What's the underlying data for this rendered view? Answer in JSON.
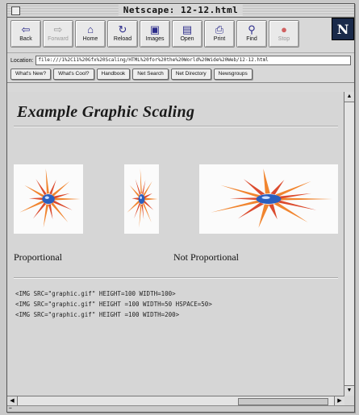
{
  "window": {
    "title": "Netscape: 12-12.html"
  },
  "toolbar": {
    "buttons": [
      {
        "label": "Back",
        "icon": "back-arrow-icon",
        "glyph": "⇦"
      },
      {
        "label": "Forward",
        "icon": "forward-arrow-icon",
        "glyph": "⇨"
      },
      {
        "label": "Home",
        "icon": "home-icon",
        "glyph": "⌂"
      },
      {
        "label": "Reload",
        "icon": "reload-icon",
        "glyph": "↻"
      },
      {
        "label": "Images",
        "icon": "images-icon",
        "glyph": "▣"
      },
      {
        "label": "Open",
        "icon": "open-icon",
        "glyph": "▤"
      },
      {
        "label": "Print",
        "icon": "print-icon",
        "glyph": "⎙"
      },
      {
        "label": "Find",
        "icon": "find-icon",
        "glyph": "⚲"
      },
      {
        "label": "Stop",
        "icon": "stop-icon",
        "glyph": "●"
      }
    ],
    "logo_letter": "N"
  },
  "location": {
    "label": "Location:",
    "url": "file:///1%2C11%20Gfx%20Scaling/HTML%20for%20the%20World%20Wide%20Web/12-12.html"
  },
  "directory_buttons": [
    "What's New?",
    "What's Cool?",
    "Handbook",
    "Net Search",
    "Net Directory",
    "Newsgroups"
  ],
  "page": {
    "heading": "Example Graphic Scaling",
    "caption_left": "Proportional",
    "caption_right": "Not Proportional",
    "code_lines": [
      "<IMG SRC=\"graphic.gif\" HEIGHT=100 WIDTH=100>",
      "<IMG SRC=\"graphic.gif\" HEIGHT =100 WIDTH=50 HSPACE=50>",
      "<IMG SRC=\"graphic.gif\" HEIGHT =100 WIDTH=200>"
    ]
  },
  "colors": {
    "star_orange": "#f07818",
    "star_red": "#d83818",
    "star_center": "#2a5fbf"
  }
}
